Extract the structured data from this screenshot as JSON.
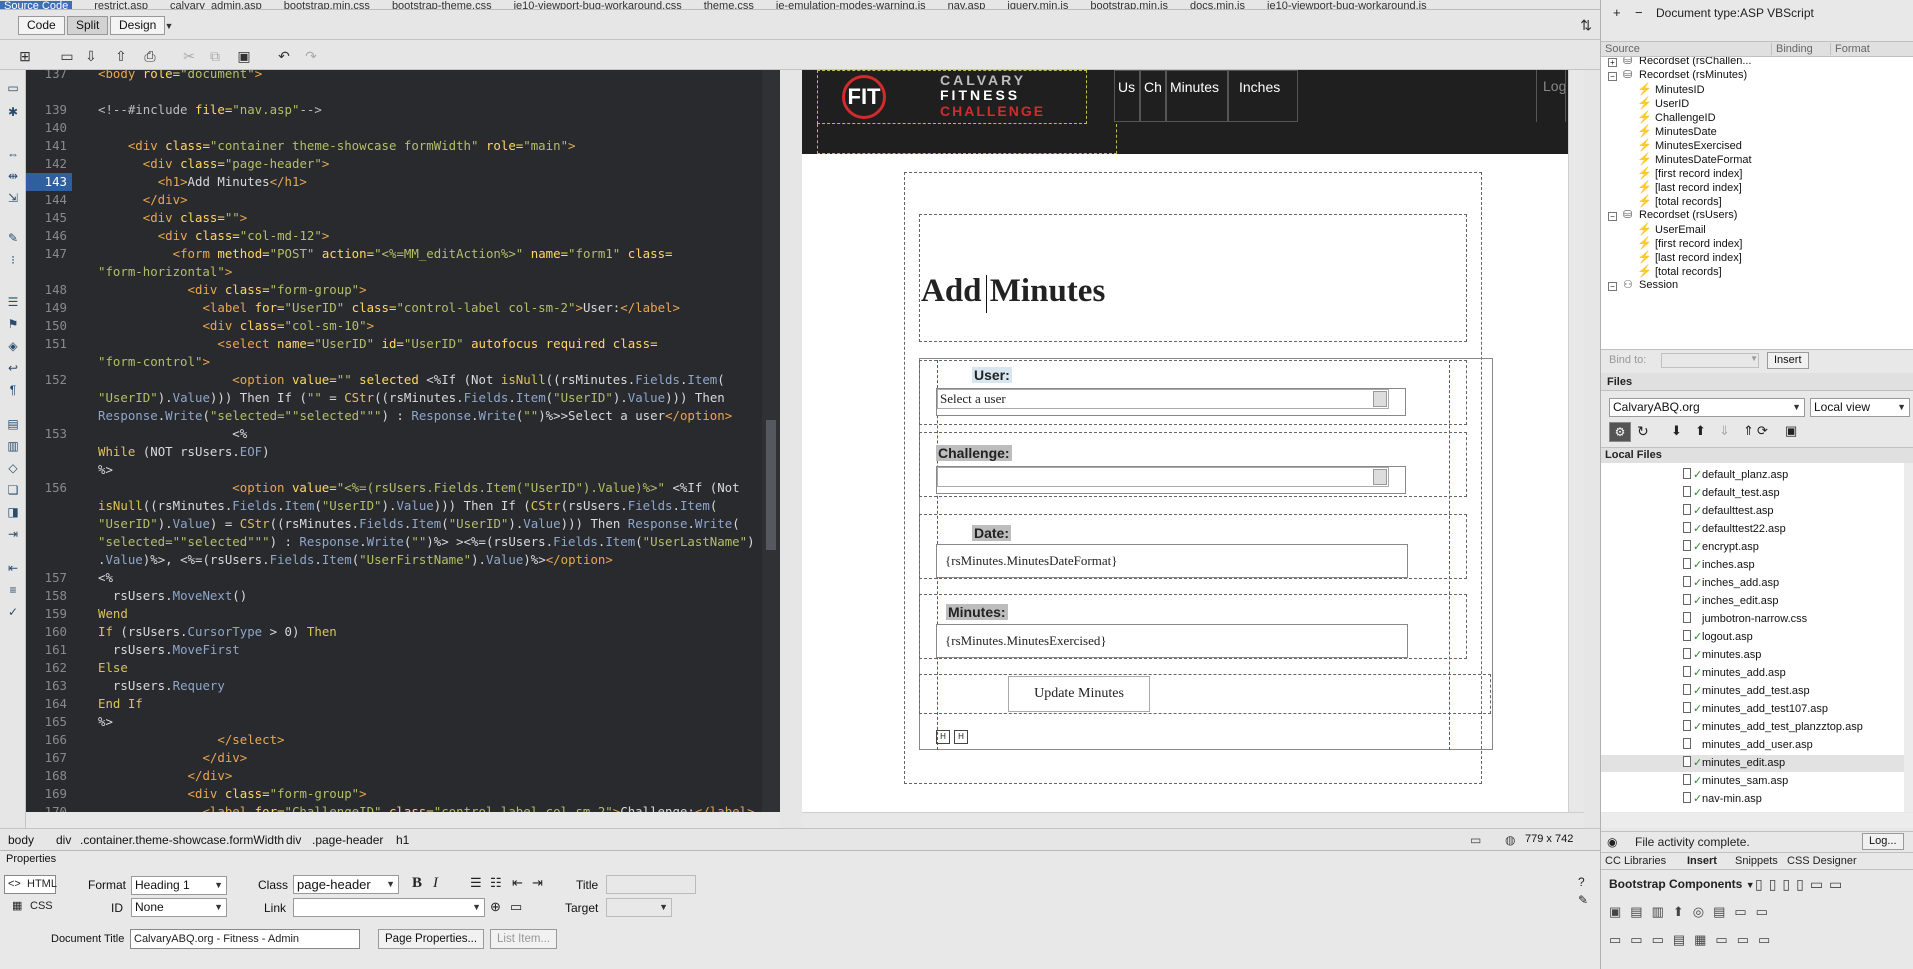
{
  "file_tabs": [
    {
      "label": "Source Code",
      "active": true
    },
    {
      "label": "restrict.asp"
    },
    {
      "label": "calvary_admin.asp"
    },
    {
      "label": "bootstrap.min.css"
    },
    {
      "label": "bootstrap-theme.css"
    },
    {
      "label": "ie10-viewport-bug-workaround.css"
    },
    {
      "label": "theme.css"
    },
    {
      "label": "ie-emulation-modes-warning.js"
    },
    {
      "label": "nav.asp"
    },
    {
      "label": "jquery.min.js"
    },
    {
      "label": "bootstrap.min.js"
    },
    {
      "label": "docs.min.js"
    },
    {
      "label": "ie10-viewport-bug-workaround.js"
    }
  ],
  "view_modes": {
    "code": "Code",
    "split": "Split",
    "design": "Design"
  },
  "code": {
    "line_numbers": [
      "137",
      "",
      "139",
      "140",
      "141",
      "142",
      "143",
      "144",
      "145",
      "146",
      "147",
      "",
      "148",
      "149",
      "150",
      "151",
      "",
      "152",
      "",
      "",
      "153",
      "",
      "",
      "156",
      "",
      "",
      "",
      "",
      "157",
      "158",
      "159",
      "160",
      "161",
      "162",
      "163",
      "164",
      "165",
      "166",
      "167",
      "168",
      "169",
      "170"
    ],
    "current_line": "143"
  },
  "design": {
    "logo_fit": "FIT",
    "logo_line1": "CALVARY",
    "logo_line2": "FITNESS",
    "logo_line3": "CHALLENGE",
    "nav_items": [
      "Us",
      "Ch",
      "Minutes",
      "Inches"
    ],
    "nav_right": "Logo",
    "heading": "Add Minutes",
    "user_label": "User:",
    "user_select": "Select a user",
    "challenge_label": "Challenge:",
    "date_label": "Date:",
    "date_value": "{rsMinutes.MinutesDateFormat}",
    "minutes_label": "Minutes:",
    "minutes_value": "{rsMinutes.MinutesExercised}",
    "submit": "Update Minutes"
  },
  "tag_bar": {
    "tags": [
      "body",
      "div",
      ".container.theme-showcase.formWidth",
      "div",
      ".page-header",
      "h1"
    ],
    "size": "779 x 742"
  },
  "properties": {
    "title": "Properties",
    "html_btn": "HTML",
    "css_btn": "CSS",
    "format_label": "Format",
    "format_value": "Heading 1",
    "class_label": "Class",
    "class_value": "page-header",
    "id_label": "ID",
    "id_value": "None",
    "link_label": "Link",
    "title_label": "Title",
    "target_label": "Target",
    "doc_title_label": "Document Title",
    "doc_title_value": "CalvaryABQ.org - Fitness - Admin",
    "page_props_btn": "Page Properties...",
    "list_item_btn": "List Item..."
  },
  "right_panel": {
    "doc_type": "Document type:ASP VBScript",
    "bind_cols": [
      "Source",
      "Binding",
      "Format"
    ],
    "bindings": [
      {
        "indent": 0,
        "exp": "+",
        "icon": "db",
        "label": "Recordset (rsChallen..."
      },
      {
        "indent": 0,
        "exp": "-",
        "icon": "db",
        "label": "Recordset (rsMinutes)"
      },
      {
        "indent": 1,
        "label": "MinutesID"
      },
      {
        "indent": 1,
        "label": "UserID"
      },
      {
        "indent": 1,
        "label": "ChallengeID"
      },
      {
        "indent": 1,
        "label": "MinutesDate"
      },
      {
        "indent": 1,
        "label": "MinutesExercised"
      },
      {
        "indent": 1,
        "label": "MinutesDateFormat"
      },
      {
        "indent": 1,
        "label": "[first record index]"
      },
      {
        "indent": 1,
        "label": "[last record index]"
      },
      {
        "indent": 1,
        "label": "[total records]"
      },
      {
        "indent": 0,
        "exp": "-",
        "icon": "db",
        "label": "Recordset (rsUsers)"
      },
      {
        "indent": 1,
        "label": "UserEmail"
      },
      {
        "indent": 1,
        "label": "[first record index]"
      },
      {
        "indent": 1,
        "label": "[last record index]"
      },
      {
        "indent": 1,
        "label": "[total records]"
      },
      {
        "indent": 0,
        "exp": "-",
        "icon": "session",
        "label": "Session"
      }
    ],
    "bind_to_label": "Bind to:",
    "insert_btn": "Insert",
    "files_title": "Files",
    "site": "CalvaryABQ.org",
    "view": "Local view",
    "local_files": "Local Files",
    "files": [
      {
        "name": "default_planz.asp",
        "check": true
      },
      {
        "name": "default_test.asp",
        "check": true
      },
      {
        "name": "defaulttest.asp",
        "check": true
      },
      {
        "name": "defaulttest22.asp",
        "check": true
      },
      {
        "name": "encrypt.asp",
        "check": true
      },
      {
        "name": "inches.asp",
        "check": true
      },
      {
        "name": "inches_add.asp",
        "check": true
      },
      {
        "name": "inches_edit.asp",
        "check": true
      },
      {
        "name": "jumbotron-narrow.css",
        "check": false
      },
      {
        "name": "logout.asp",
        "check": true
      },
      {
        "name": "minutes.asp",
        "check": true
      },
      {
        "name": "minutes_add.asp",
        "check": true
      },
      {
        "name": "minutes_add_test.asp",
        "check": true
      },
      {
        "name": "minutes_add_test107.asp",
        "check": true
      },
      {
        "name": "minutes_add_test_planzztop.asp",
        "check": true
      },
      {
        "name": "minutes_add_user.asp",
        "check": false
      },
      {
        "name": "minutes_edit.asp",
        "check": true,
        "selected": true
      },
      {
        "name": "minutes_sam.asp",
        "check": true
      },
      {
        "name": "nav-min.asp",
        "check": true
      }
    ],
    "status": "File activity complete.",
    "log_btn": "Log...",
    "bottom_tabs": [
      "CC Libraries",
      "Insert",
      "Snippets",
      "CSS Designer"
    ],
    "components": "Bootstrap Components"
  }
}
